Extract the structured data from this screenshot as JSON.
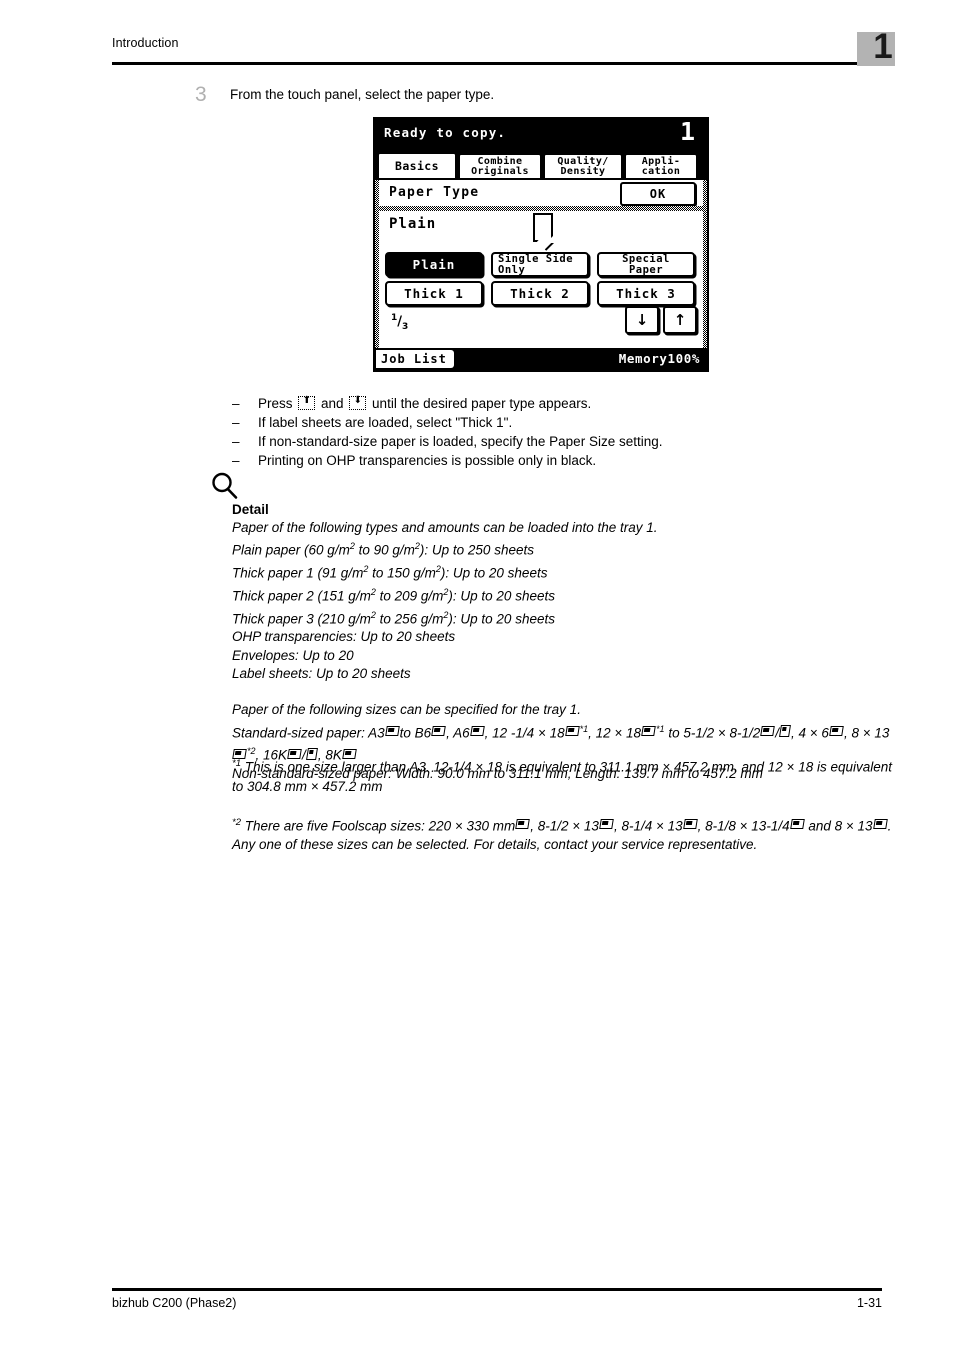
{
  "header": {
    "title": "Introduction",
    "chapter_number": "1"
  },
  "step": {
    "number": "3",
    "text": "From the touch panel, select the paper type."
  },
  "lcd": {
    "status": "Ready to copy.",
    "copies": "1",
    "tabs": [
      {
        "line1": "Basics",
        "line2": "",
        "active": true
      },
      {
        "line1": "Combine",
        "line2": "Originals",
        "active": false
      },
      {
        "line1": "Quality/",
        "line2": "Density",
        "active": false
      },
      {
        "line1": "Appli-",
        "line2": "cation",
        "active": false
      }
    ],
    "section_title": "Paper Type",
    "ok_label": "OK",
    "current_value": "Plain",
    "buttons": [
      {
        "line1": "Plain",
        "line2": "",
        "selected": true
      },
      {
        "line1": "Single Side",
        "line2": "Only",
        "selected": false
      },
      {
        "line1": "Special",
        "line2": "Paper",
        "selected": false
      },
      {
        "line1": "Thick 1",
        "line2": "",
        "selected": false
      },
      {
        "line1": "Thick 2",
        "line2": "",
        "selected": false
      },
      {
        "line1": "Thick 3",
        "line2": "",
        "selected": false
      }
    ],
    "page_current": "1",
    "page_total": "3",
    "arrow_down": "↓",
    "arrow_up": "↑",
    "job_list": "Job List",
    "memory": "Memory100%"
  },
  "bullets": [
    {
      "dash": "–",
      "pre": "Press ",
      "key1": "⬆",
      "mid": " and ",
      "key2": "⬇",
      "post": " until the desired paper type appears."
    },
    {
      "dash": "–",
      "text": "If label sheets are loaded, select \"Thick 1\"."
    },
    {
      "dash": "–",
      "text": "If non-standard-size paper is loaded, specify the Paper Size setting."
    },
    {
      "dash": "–",
      "text": "Printing on OHP transparencies is possible only in black."
    }
  ],
  "detail": {
    "icon": "magnifier-icon",
    "title": "Detail",
    "intro": "Paper of the following types and amounts can be loaded into the tray 1.",
    "plain_paper": "Plain paper (60 g/m",
    "lines": [
      "Paper of the following types and amounts can be loaded into the tray 1.",
      "Plain paper (60 g/m2 to 90 g/m2): Up to 250 sheets",
      "Thick paper 1 (91 g/m2 to 150 g/m2): Up to 20 sheets",
      "Thick paper 2 (151 g/m2 to 209 g/m2): Up to 20 sheets",
      "Thick paper 3 (210 g/m2 to 256 g/m2): Up to 20 sheets",
      "OHP transparencies: Up to 20 sheets",
      "Envelopes: Up to 20",
      "Label sheets: Up to 20 sheets"
    ],
    "sizes_intro": "Paper of the following sizes can be specified for the tray 1.",
    "standard_label": "Standard-sized paper:",
    "standard_text_a": "A3",
    "standard_text_b": "to B6",
    "standard_text_c": ", A6",
    "standard_text_d": ", 12 -1/4 × 18",
    "standard_text_e": ", 12 × 18",
    "standard_text_f": "to 5-1/2 × 8-1/2",
    "standard_text_g": "4 × 6",
    "standard_text_h": ", 8 × 13",
    "standard_text_i": ", 16K",
    "standard_text_j": ", 8K",
    "nonstandard": "Non-standard-sized paper: Width: 90.0 mm to 311.1 mm; Length: 139.7 mm to 457.2 mm"
  },
  "footnote1": {
    "marker": "*1",
    "text": "This is one size larger than A3. 12-1/4 × 18 is equivalent to 311.1 mm × 457.2 mm, and 12 × 18 is equivalent to 304.8 mm × 457.2 mm"
  },
  "footnote2": {
    "marker": "*2",
    "part_a": "There are five Foolscap sizes: 220 × 330 mm",
    "part_b": ", 8-1/2 × 13",
    "part_c": ", 8-1/4 × 13",
    "part_d": ", 8-1/8 × 13-1/4",
    "part_e": "and",
    "part_f": "8 × 13",
    "part_g": ". Any one of these sizes can be selected. For details, contact your service representative."
  },
  "footer": {
    "left": "bizhub C200 (Phase2)",
    "right": "1-31"
  }
}
